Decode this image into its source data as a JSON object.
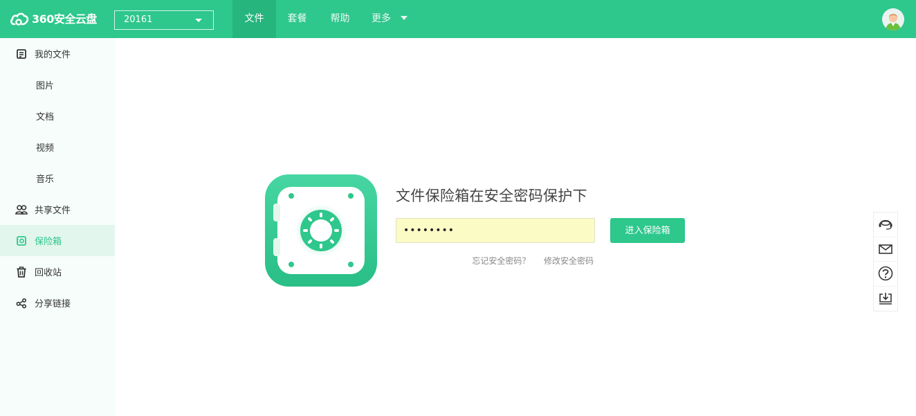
{
  "header": {
    "logo_text": "360安全云盘",
    "account": "20161",
    "nav": [
      {
        "label": "文件",
        "active": true
      },
      {
        "label": "套餐",
        "active": false
      },
      {
        "label": "帮助",
        "active": false
      },
      {
        "label": "更多",
        "active": false
      }
    ]
  },
  "sidebar": {
    "items": [
      {
        "label": "我的文件",
        "icon": "my-files-icon"
      },
      {
        "label": "图片"
      },
      {
        "label": "文档"
      },
      {
        "label": "视频"
      },
      {
        "label": "音乐"
      },
      {
        "label": "共享文件",
        "icon": "shared-users-icon"
      },
      {
        "label": "保险箱",
        "icon": "safe-icon",
        "active": true
      },
      {
        "label": "回收站",
        "icon": "trash-icon"
      },
      {
        "label": "分享链接",
        "icon": "share-link-icon"
      }
    ]
  },
  "vault": {
    "title": "文件保险箱在安全密码保护下",
    "password_value": "••••••••",
    "enter_button": "进入保险箱",
    "forgot_link": "忘记安全密码？",
    "change_link": "修改安全密码"
  },
  "float_toolbar": {
    "icons": [
      "customer-service-icon",
      "mail-icon",
      "help-icon",
      "download-icon"
    ]
  },
  "colors": {
    "brand": "#2ec78c",
    "sidebar_bg": "#f6fdfb",
    "active_bg": "#e2f6ee",
    "input_bg": "#fbfbc6"
  }
}
